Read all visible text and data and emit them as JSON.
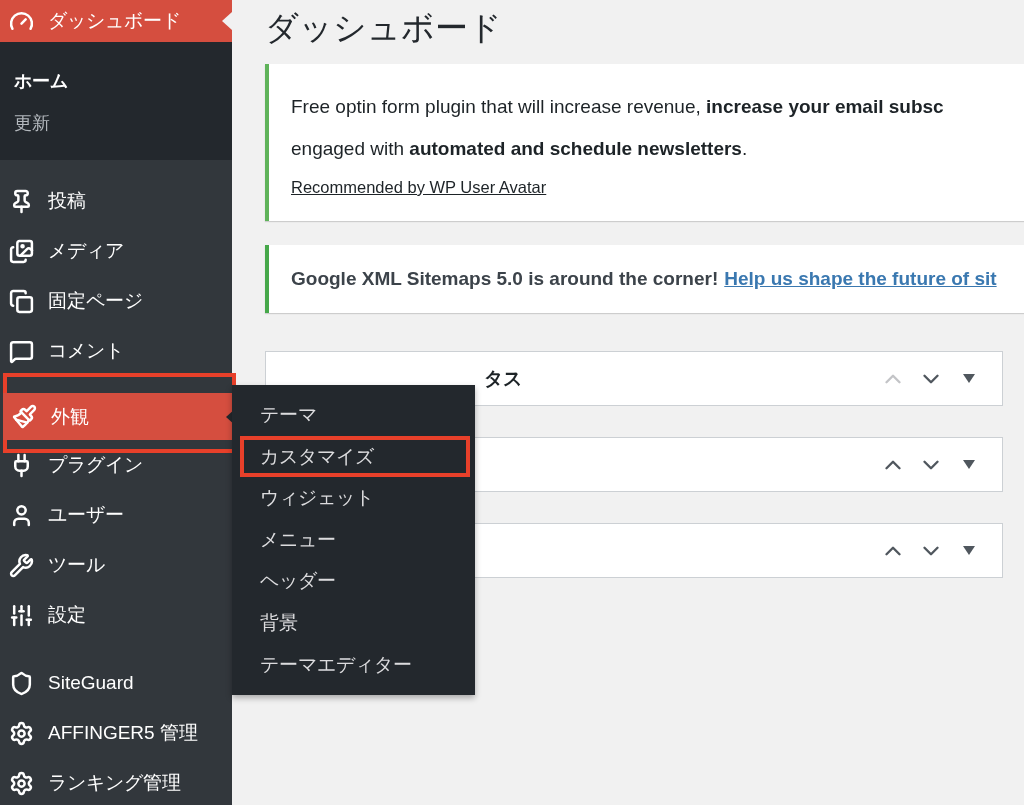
{
  "page_title": "ダッシュボード",
  "sidebar": {
    "sections": [
      {
        "items": [
          {
            "label": "ダッシュボード",
            "selected": true,
            "open": false,
            "highlighted": false,
            "submenu": [
              {
                "label": "ホーム",
                "selected": true,
                "highlighted": false
              },
              {
                "label": "更新",
                "selected": false,
                "highlighted": false
              }
            ]
          },
          {
            "label": "投稿",
            "selected": false,
            "open": false,
            "highlighted": false
          },
          {
            "label": "メディア",
            "selected": false,
            "open": false,
            "highlighted": false
          },
          {
            "label": "固定ページ",
            "selected": false,
            "open": false,
            "highlighted": false
          },
          {
            "label": "コメント",
            "selected": false,
            "open": false,
            "highlighted": false
          },
          {
            "label": "外観",
            "selected": false,
            "open": true,
            "highlighted": true,
            "submenu": [
              {
                "label": "テーマ",
                "selected": false,
                "highlighted": false
              },
              {
                "label": "カスタマイズ",
                "selected": false,
                "highlighted": true
              },
              {
                "label": "ウィジェット",
                "selected": false,
                "highlighted": false
              },
              {
                "label": "メニュー",
                "selected": false,
                "highlighted": false
              },
              {
                "label": "ヘッダー",
                "selected": false,
                "highlighted": false
              },
              {
                "label": "背景",
                "selected": false,
                "highlighted": false
              },
              {
                "label": "テーマエディター",
                "selected": false,
                "highlighted": false
              }
            ]
          },
          {
            "label": "プラグイン",
            "selected": false,
            "open": false,
            "highlighted": false
          },
          {
            "label": "ユーザー",
            "selected": false,
            "open": false,
            "highlighted": false
          },
          {
            "label": "ツール",
            "selected": false,
            "open": false,
            "highlighted": false
          },
          {
            "label": "設定",
            "selected": false,
            "open": false,
            "highlighted": false
          }
        ]
      },
      {
        "items": [
          {
            "label": "SiteGuard",
            "selected": false,
            "open": false,
            "highlighted": false
          },
          {
            "label": "AFFINGER5 管理",
            "selected": false,
            "open": false,
            "highlighted": false
          },
          {
            "label": "ランキング管理",
            "selected": false,
            "open": false,
            "highlighted": false
          }
        ]
      }
    ]
  },
  "notices": [
    {
      "kind": "promo",
      "text": "Free optin form plugin that will increase revenue, **increase your email subsc**\nengaged with **automated and schedule newsletters**.",
      "link": "Recommended by WP User Avatar"
    },
    {
      "kind": "info",
      "text": "Google XML Sitemaps 5.0 is around the corner!",
      "link": "Help us shape the future of sit"
    }
  ],
  "postboxes": [
    {
      "title": "タス",
      "can_move_up": false
    },
    {
      "can_move_up": true
    },
    {
      "can_move_up": true
    }
  ]
}
